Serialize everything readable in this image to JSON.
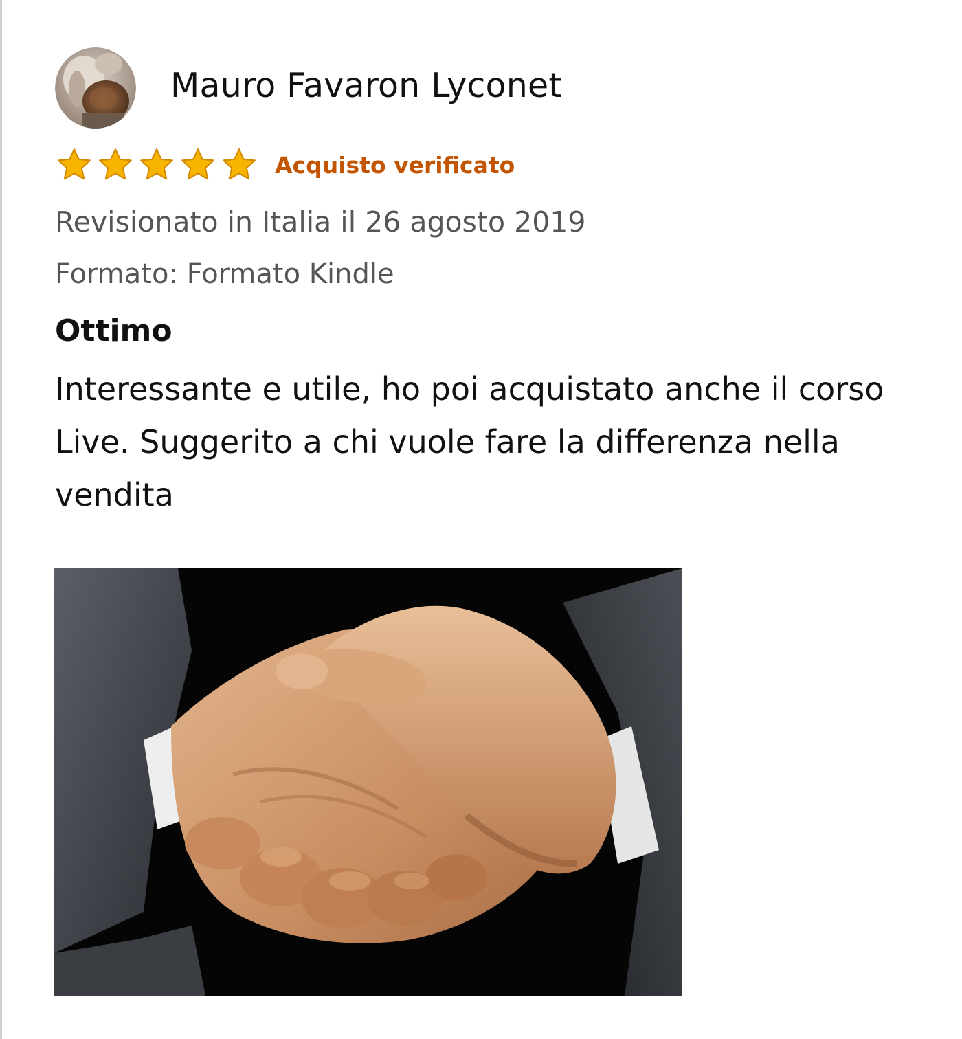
{
  "review": {
    "reviewer_name": "Mauro Favaron Lyconet",
    "rating": 5,
    "rating_max": 5,
    "verified_label": "Acquisto verificato",
    "review_date_text": "Revisionato in Italia il 26 agosto 2019",
    "format_text": "Formato: Formato Kindle",
    "title": "Ottimo",
    "body": "Interessante e utile, ho poi acquistato anche il corso Live. Suggerito a chi vuole fare la differenza nella vendita"
  },
  "colors": {
    "star": "#f7b500",
    "verified": "#c45500",
    "meta": "#555555",
    "text": "#111111"
  }
}
